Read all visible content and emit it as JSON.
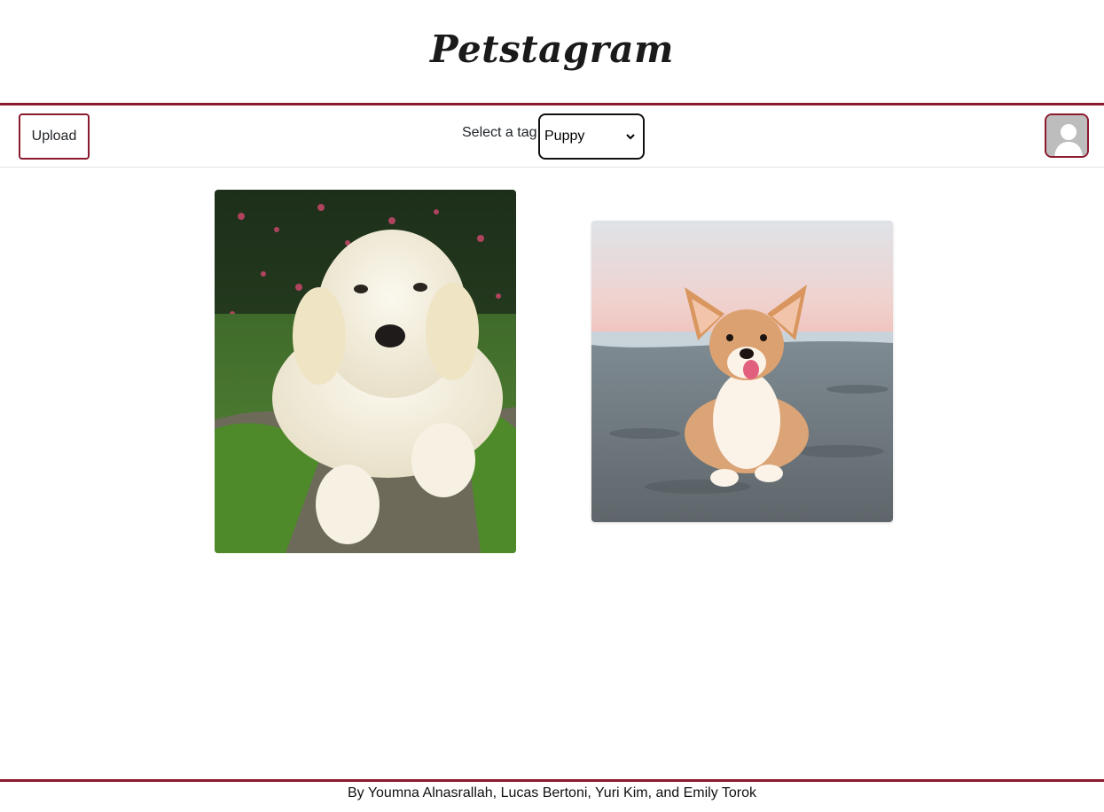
{
  "header": {
    "title": "Petstagram"
  },
  "toolbar": {
    "upload_label": "Upload",
    "tag_label": "Select a tag:",
    "tag_selected": "Puppy",
    "avatar_icon": "user-avatar-icon"
  },
  "feed": {
    "posts": [
      {
        "subject": "white golden retriever puppy lying on mossy log"
      },
      {
        "subject": "corgi lying on sandy beach at sunset"
      }
    ]
  },
  "footer": {
    "credits": "By Youmna Alnasrallah, Lucas Bertoni, Yuri Kim, and Emily Torok"
  },
  "colors": {
    "accent": "#8b1a2e",
    "avatar_bg": "#bdbdbd"
  }
}
